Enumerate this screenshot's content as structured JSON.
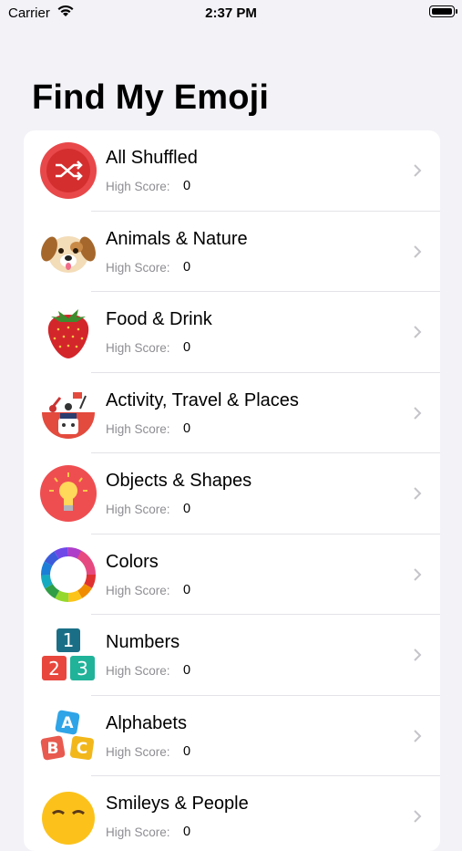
{
  "status_bar": {
    "carrier": "Carrier",
    "time": "2:37 PM"
  },
  "page": {
    "title": "Find My Emoji"
  },
  "list": {
    "items": [
      {
        "title": "All Shuffled",
        "score_label": "High Score:",
        "score": "0",
        "icon": "shuffle-icon"
      },
      {
        "title": "Animals & Nature",
        "score_label": "High Score:",
        "score": "0",
        "icon": "dog-icon"
      },
      {
        "title": "Food & Drink",
        "score_label": "High Score:",
        "score": "0",
        "icon": "strawberry-icon"
      },
      {
        "title": "Activity, Travel & Places",
        "score_label": "High Score:",
        "score": "0",
        "icon": "activity-icon"
      },
      {
        "title": "Objects & Shapes",
        "score_label": "High Score:",
        "score": "0",
        "icon": "lightbulb-icon"
      },
      {
        "title": "Colors",
        "score_label": "High Score:",
        "score": "0",
        "icon": "color-wheel-icon"
      },
      {
        "title": "Numbers",
        "score_label": "High Score:",
        "score": "0",
        "icon": "number-blocks-icon"
      },
      {
        "title": "Alphabets",
        "score_label": "High Score:",
        "score": "0",
        "icon": "alphabet-blocks-icon"
      },
      {
        "title": "Smileys & People",
        "score_label": "High Score:",
        "score": "0",
        "icon": "smiley-icon"
      }
    ]
  }
}
